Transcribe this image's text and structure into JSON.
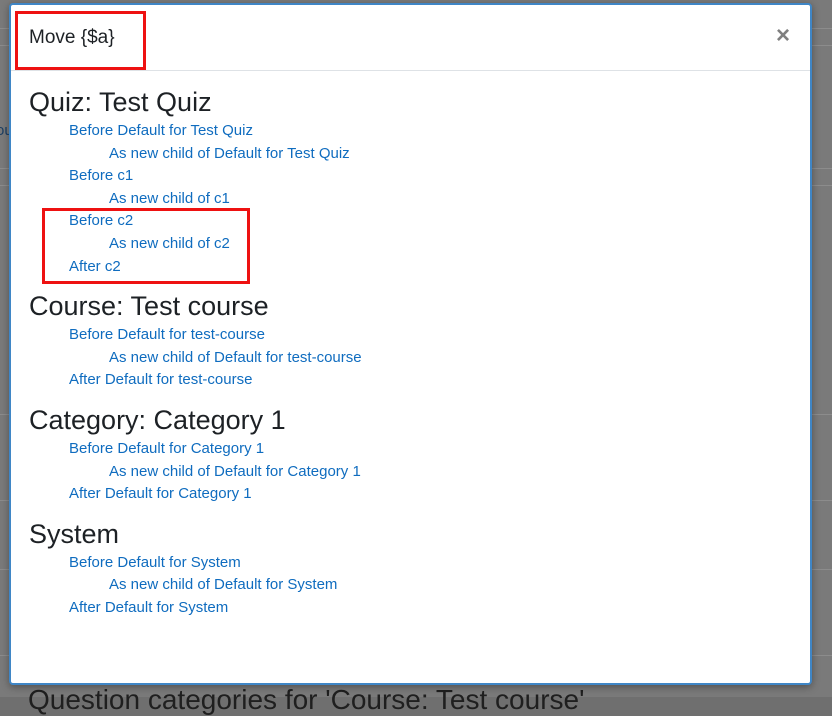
{
  "background": {
    "fragment": "ou",
    "heading": "Question categories for 'Course: Test course'"
  },
  "dialog": {
    "title": "Move {$a}",
    "close_glyph": "×"
  },
  "sections": [
    {
      "heading": "Quiz: Test Quiz",
      "links": [
        {
          "text": "Before Default for Test Quiz",
          "indent": 1
        },
        {
          "text": "As new child of Default for Test Quiz",
          "indent": 2
        },
        {
          "text": "Before c1",
          "indent": 1
        },
        {
          "text": "As new child of c1",
          "indent": 2
        },
        {
          "text": "Before c2",
          "indent": 1
        },
        {
          "text": "As new child of c2",
          "indent": 2
        },
        {
          "text": "After c2",
          "indent": 1
        }
      ]
    },
    {
      "heading": "Course: Test course",
      "links": [
        {
          "text": "Before Default for test-course",
          "indent": 1
        },
        {
          "text": "As new child of Default for test-course",
          "indent": 2
        },
        {
          "text": "After Default for test-course",
          "indent": 1
        }
      ]
    },
    {
      "heading": "Category: Category 1",
      "links": [
        {
          "text": "Before Default for Category 1",
          "indent": 1
        },
        {
          "text": "As new child of Default for Category 1",
          "indent": 2
        },
        {
          "text": "After Default for Category 1",
          "indent": 1
        }
      ]
    },
    {
      "heading": "System",
      "links": [
        {
          "text": "Before Default for System",
          "indent": 1
        },
        {
          "text": "As new child of Default for System",
          "indent": 2
        },
        {
          "text": "After Default for System",
          "indent": 1
        }
      ]
    }
  ],
  "colors": {
    "link": "#0f6cbf",
    "annotation": "#ee1111",
    "modal_border": "#3f86c6"
  }
}
